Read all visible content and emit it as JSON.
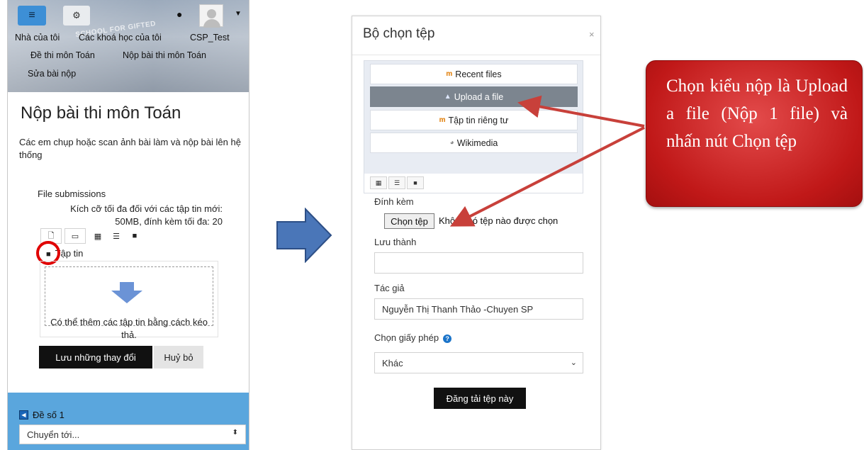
{
  "left_panel": {
    "navbar": {
      "menu_icon": "hamburger-icon",
      "settings_icon": "gear-icon",
      "message_icon": "speech-bubble-icon",
      "user_icon": "avatar-icon",
      "dropdown_icon": "caret-down-icon"
    },
    "hero_watermark": "SCHOOL FOR GIFTED",
    "breadcrumbs": [
      "Nhà của tôi",
      "Các khoá học của tôi",
      "CSP_Test",
      "Đề thi môn Toán",
      "Nộp bài thi môn Toán",
      "Sửa bài nộp"
    ],
    "page_title": "Nộp bài thi môn Toán",
    "description": "Các em chụp hoặc scan ảnh bài làm và nộp bài lên hệ thống",
    "file_submissions_label": "File submissions",
    "limit_text": "Kích cỡ tối đa đối với các tập tin mới: 50MB, đính kèm tối đa: 20",
    "folder_label": "Tập tin",
    "dropzone_text": "Có thể thêm các tập tin bằng cách kéo thả.",
    "save_button": "Lưu những thay đổi",
    "cancel_button": "Huỷ bỏ",
    "prev_section": "Đề số 1",
    "jump_select": "Chuyển tới..."
  },
  "dialog": {
    "title": "Bộ chọn tệp",
    "close": "×",
    "repositories": [
      {
        "label": "Recent files",
        "icon": "moodle-icon",
        "icon_glyph": "m",
        "active": false
      },
      {
        "label": "Upload a file",
        "icon": "upload-icon",
        "icon_glyph": "▲",
        "active": true
      },
      {
        "label": "Tập tin riêng tư",
        "icon": "moodle-icon",
        "icon_glyph": "m",
        "active": false
      },
      {
        "label": "Wikimedia",
        "icon": "globe-icon",
        "icon_glyph": "◕",
        "active": false
      }
    ],
    "attachment_label": "Đính kèm",
    "choose_button": "Chọn tệp",
    "no_file": "Không có tệp nào được chọn",
    "save_as_label": "Lưu thành",
    "save_as_value": "",
    "author_label": "Tác giả",
    "author_value": "Nguyễn Thị Thanh Thảo -Chuyen SP",
    "license_label": "Chọn giấy phép",
    "license_value": "Khác",
    "upload_button": "Đăng tải tệp này"
  },
  "callout": {
    "text": "Chọn kiểu nộp là Upload a file (Nộp 1 file) và nhấn nút Chọn tệp",
    "color": "#c01818"
  },
  "colors": {
    "menu_blue": "#3d8fd6",
    "footer_blue": "#5aa6dd",
    "arrow_blue": "#4a76b8",
    "highlight_red": "#e00000"
  }
}
